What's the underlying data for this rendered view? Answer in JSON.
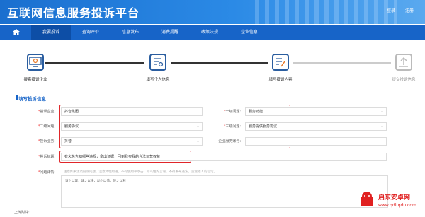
{
  "header": {
    "title": "互联网信息服务投诉平台",
    "login": "登录",
    "register": "注册"
  },
  "nav": {
    "tabs": [
      "我要投诉",
      "查询评价",
      "信息发布",
      "消费提醒",
      "政策法规",
      "企业信息"
    ],
    "active_index": 0
  },
  "steps": [
    {
      "label": "搜索投诉企业"
    },
    {
      "label": "填写个人信息"
    },
    {
      "label": "填写投诉内容"
    },
    {
      "label": "提交投诉信息"
    }
  ],
  "section": {
    "title": "填写投诉信息"
  },
  "form": {
    "company_label": "投诉企业:",
    "company_value": "抖音集团",
    "level1_label": "一级问题:",
    "level1_value": "服务功能",
    "level2_label": "二级问题:",
    "level2_value": "服务协议",
    "level3_label": "三级问题:",
    "level3_value": "服务提供服务协议",
    "business_label": "投诉业务:",
    "business_value": "抖音",
    "account_label": "企业服务账号:",
    "subject_label": "投诉标题:",
    "subject_value": "有义务告知哪些违规，拿出证据，回到我买我的合法运营权益",
    "detail_label": "问题详情:",
    "detail_hint": "注意如果涉及投诉问题，注意文明用语，不得使用带攻击、辱骂性的言语，不得发布违法，造谣他人的言论。",
    "detail_text": "请之以理，诚之以法，动之以情，晓之以利",
    "attach_label": "上传附件:"
  },
  "watermark": {
    "name": "启东安卓网",
    "url": "www.qdltqdu.com"
  },
  "colors": {
    "brand": "#1764c8",
    "highlight": "#e0262a"
  }
}
